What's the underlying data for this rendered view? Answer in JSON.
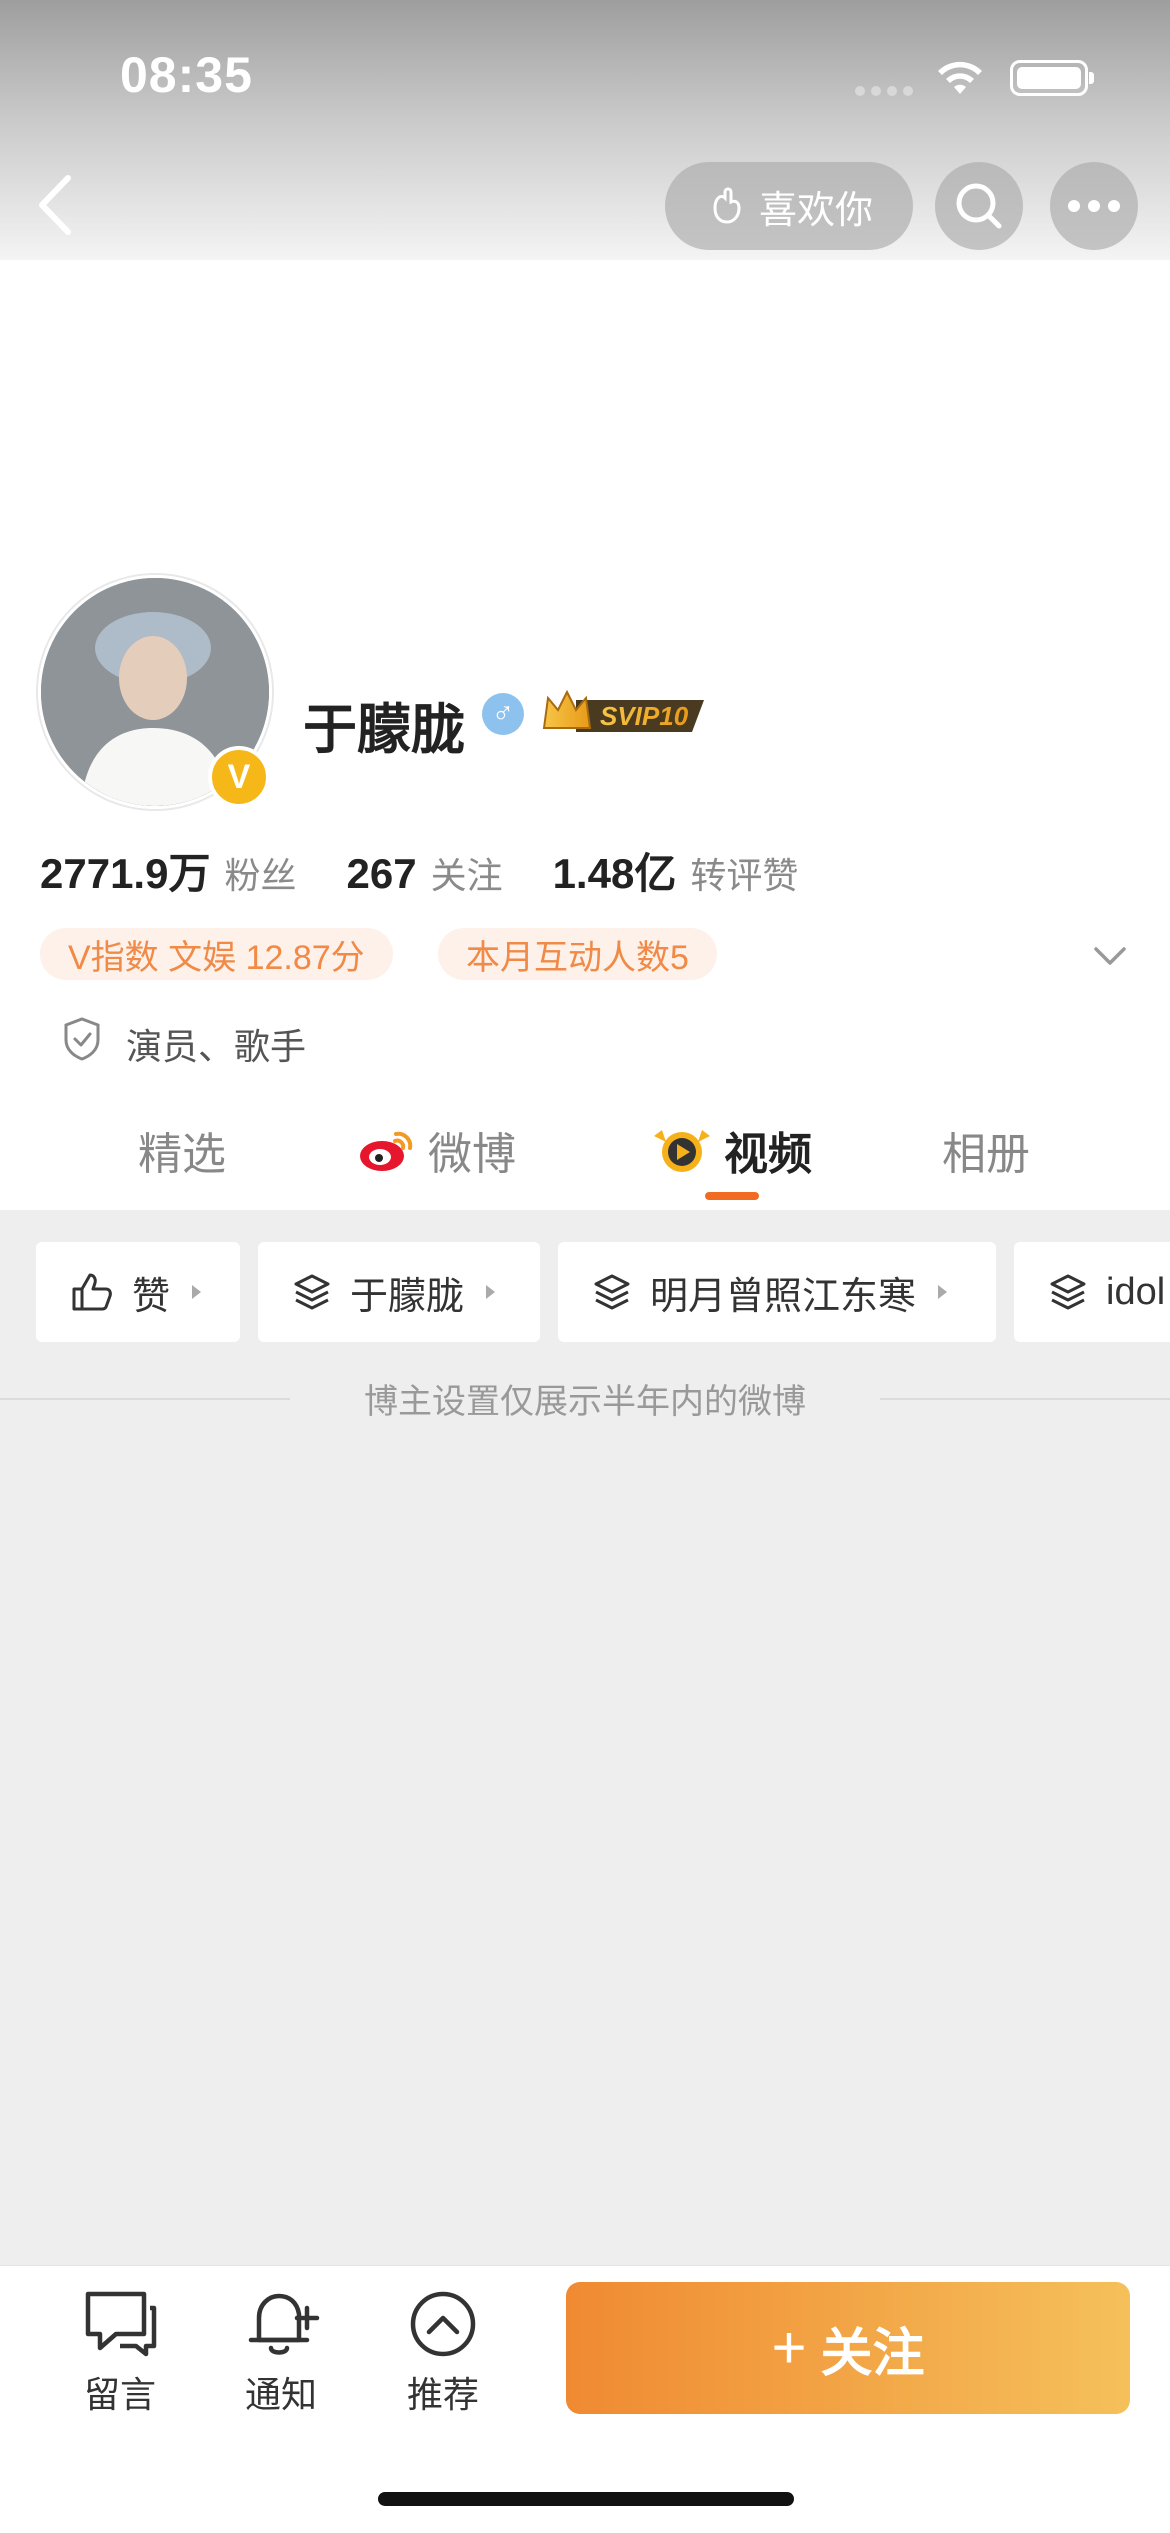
{
  "status_bar": {
    "time": "08:35"
  },
  "header": {
    "like_button_label": "喜欢你",
    "icons": {
      "back": "chevron-left-icon",
      "search": "search-icon",
      "more": "more-dots-icon"
    }
  },
  "profile": {
    "name": "于朦胧",
    "verified_badge": "V",
    "gender_symbol": "♂",
    "svip_label": "SVIP10",
    "stats": [
      {
        "value": "2771.9万",
        "label": "粉丝"
      },
      {
        "value": "267",
        "label": "关注"
      },
      {
        "value": "1.48亿",
        "label": "转评赞"
      }
    ],
    "tags": [
      "V指数 文娱 12.87分",
      "本月互动人数5"
    ],
    "occupation": "演员、歌手"
  },
  "tabs": [
    {
      "label": "精选",
      "active": false
    },
    {
      "label": "微博",
      "active": false
    },
    {
      "label": "视频",
      "active": true
    },
    {
      "label": "相册",
      "active": false
    }
  ],
  "filter_chips": [
    "赞",
    "于朦胧",
    "明月曾照江东寒",
    "idol"
  ],
  "notice": "博主设置仅展示半年内的微博",
  "bottom_bar": {
    "items": [
      "留言",
      "通知",
      "推荐"
    ],
    "follow_label": "关注",
    "follow_plus": "+"
  },
  "colors": {
    "accent": "#f26b23",
    "follow_start": "#f08a32",
    "follow_end": "#f5c05a",
    "tag_text": "#f08a46"
  }
}
